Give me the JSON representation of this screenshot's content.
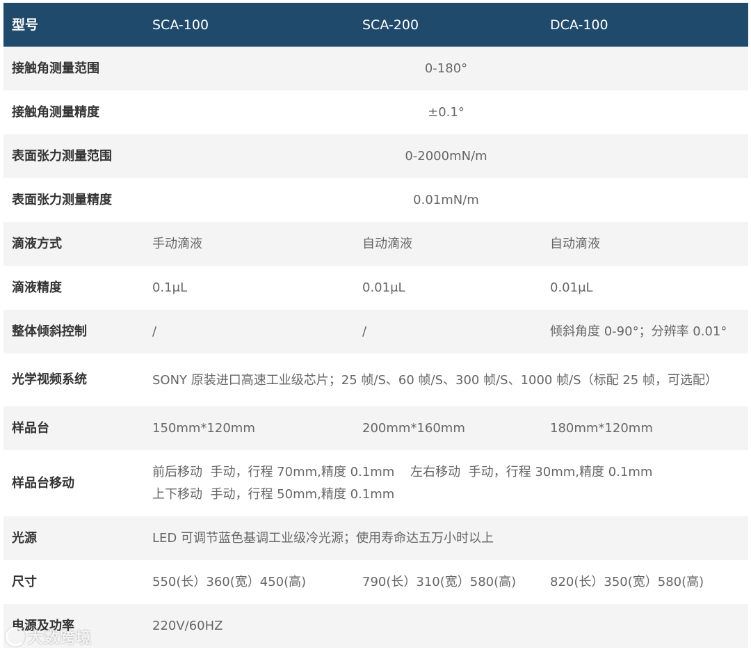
{
  "header": [
    "型号",
    "SCA-100",
    "SCA-200",
    "DCA-100"
  ],
  "rows": {
    "r1": {
      "label": "接触角测量范围",
      "span": "0-180°"
    },
    "r2": {
      "label": "接触角测量精度",
      "span": "±0.1°"
    },
    "r3": {
      "label": "表面张力测量范围",
      "span": "0-2000mN/m"
    },
    "r4": {
      "label": "表面张力测量精度",
      "span": "0.01mN/m"
    },
    "r5": {
      "label": "滴液方式",
      "c1": "手动滴液",
      "c2": "自动滴液",
      "c3": "自动滴液"
    },
    "r6": {
      "label": "滴液精度",
      "c1": "0.1μL",
      "c2": "0.01μL",
      "c3": "0.01μL"
    },
    "r7": {
      "label": "整体倾斜控制",
      "c1": "/",
      "c2": "/",
      "c3": "倾斜角度 0-90°；分辨率 0.01°"
    },
    "r8": {
      "label": "光学视频系统",
      "span": "SONY 原装进口高速工业级芯片；25 帧/S、60 帧/S、300 帧/S、1000 帧/S（标配 25 帧，可选配）"
    },
    "r9": {
      "label": "样品台",
      "c1": "150mm*120mm",
      "c2": "200mm*160mm",
      "c3": "180mm*120mm"
    },
    "r10": {
      "label": "样品台移动",
      "line1": "前后移动  手动，行程 70mm,精度 0.1mm    左右移动  手动，行程 30mm,精度 0.1mm",
      "line2": "上下移动  手动，行程 50mm,精度 0.1mm"
    },
    "r11": {
      "label": "光源",
      "span": "LED 可调节蓝色基调工业级冷光源；使用寿命达五万小时以上"
    },
    "r12": {
      "label": "尺寸",
      "c1": "550(长）360(宽）450(高)",
      "c2": "790(长）310(宽）580(高)",
      "c3": "820(长）350(宽）580(高)"
    },
    "r13": {
      "label": "电源及功率",
      "span": "220V/60HZ"
    }
  },
  "watermark": "大数跨境",
  "colors": {
    "header_bg": "#204a6b",
    "shade_bg": "#f4f4f4"
  }
}
